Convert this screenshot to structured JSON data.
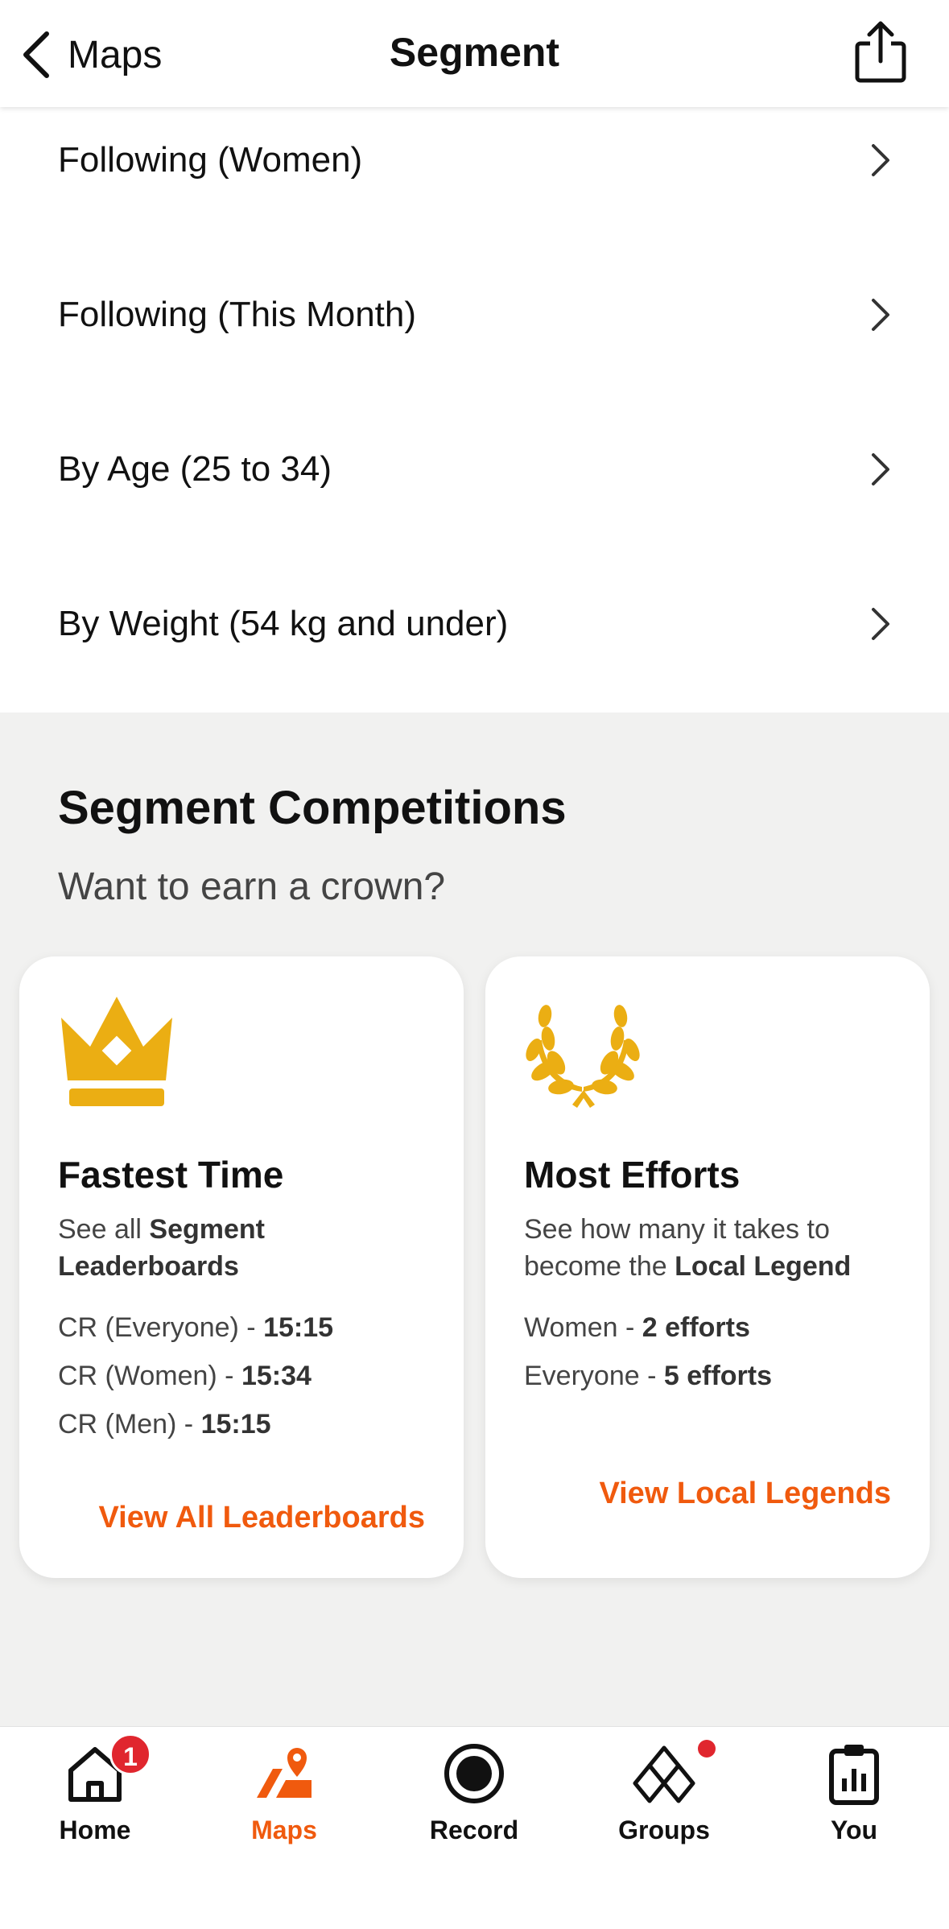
{
  "header": {
    "back_label": "Maps",
    "title": "Segment"
  },
  "leaderboard_list": [
    {
      "label": "Following (Women)"
    },
    {
      "label": "Following (This Month)"
    },
    {
      "label": "By Age (25 to 34)"
    },
    {
      "label": "By Weight (54 kg and under)"
    }
  ],
  "competitions": {
    "title": "Segment Competitions",
    "subtitle": "Want to earn a crown?",
    "fastest": {
      "title": "Fastest Time",
      "desc_prefix": "See all ",
      "desc_bold": "Segment Leaderboards",
      "stats": [
        {
          "label": "CR (Everyone) - ",
          "value": "15:15"
        },
        {
          "label": "CR (Women) - ",
          "value": "15:34"
        },
        {
          "label": "CR (Men) - ",
          "value": "15:15"
        }
      ],
      "link": "View All Leaderboards"
    },
    "efforts": {
      "title": "Most Efforts",
      "desc_prefix": "See how many it takes to become the ",
      "desc_bold": "Local Legend",
      "stats": [
        {
          "label": "Women - ",
          "value": "2 efforts"
        },
        {
          "label": "Everyone - ",
          "value": "5 efforts"
        }
      ],
      "link": "View Local Legends"
    }
  },
  "tabbar": {
    "items": [
      {
        "label": "Home",
        "icon": "home-icon",
        "badge": "1"
      },
      {
        "label": "Maps",
        "icon": "maps-icon",
        "active": true
      },
      {
        "label": "Record",
        "icon": "record-icon"
      },
      {
        "label": "Groups",
        "icon": "groups-icon"
      },
      {
        "label": "You",
        "icon": "you-icon"
      }
    ]
  },
  "colors": {
    "accent": "#f05a0e",
    "gold": "#ebae13",
    "badge": "#e0262e"
  }
}
